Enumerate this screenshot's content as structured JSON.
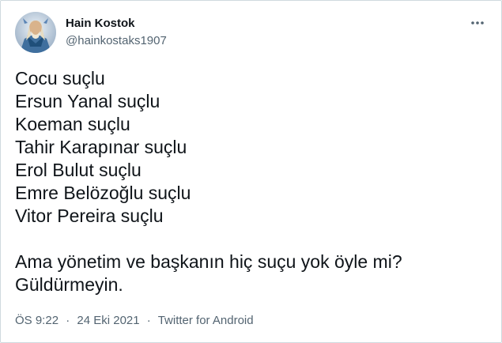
{
  "author": {
    "display_name": "Hain Kostok",
    "handle": "@hainkostaks1907"
  },
  "icons": {
    "avatar": "avatar-image",
    "more": "more-options-icon"
  },
  "tweet": {
    "lines": [
      "Cocu suçlu",
      "Ersun Yanal suçlu",
      "Koeman suçlu",
      "Tahir Karapınar suçlu",
      "Erol Bulut suçlu",
      "Emre Belözoğlu suçlu",
      "Vitor Pereira suçlu"
    ],
    "paragraph_lines": [
      "Ama yönetim ve başkanın hiç suçu yok öyle mi?",
      "Güldürmeyin."
    ]
  },
  "meta": {
    "time": "ÖS 9:22",
    "separator": "·",
    "date": "24 Eki 2021",
    "source": "Twitter for Android"
  },
  "colors": {
    "text": "#0f1419",
    "secondary": "#536471",
    "border": "#cfd9de"
  }
}
